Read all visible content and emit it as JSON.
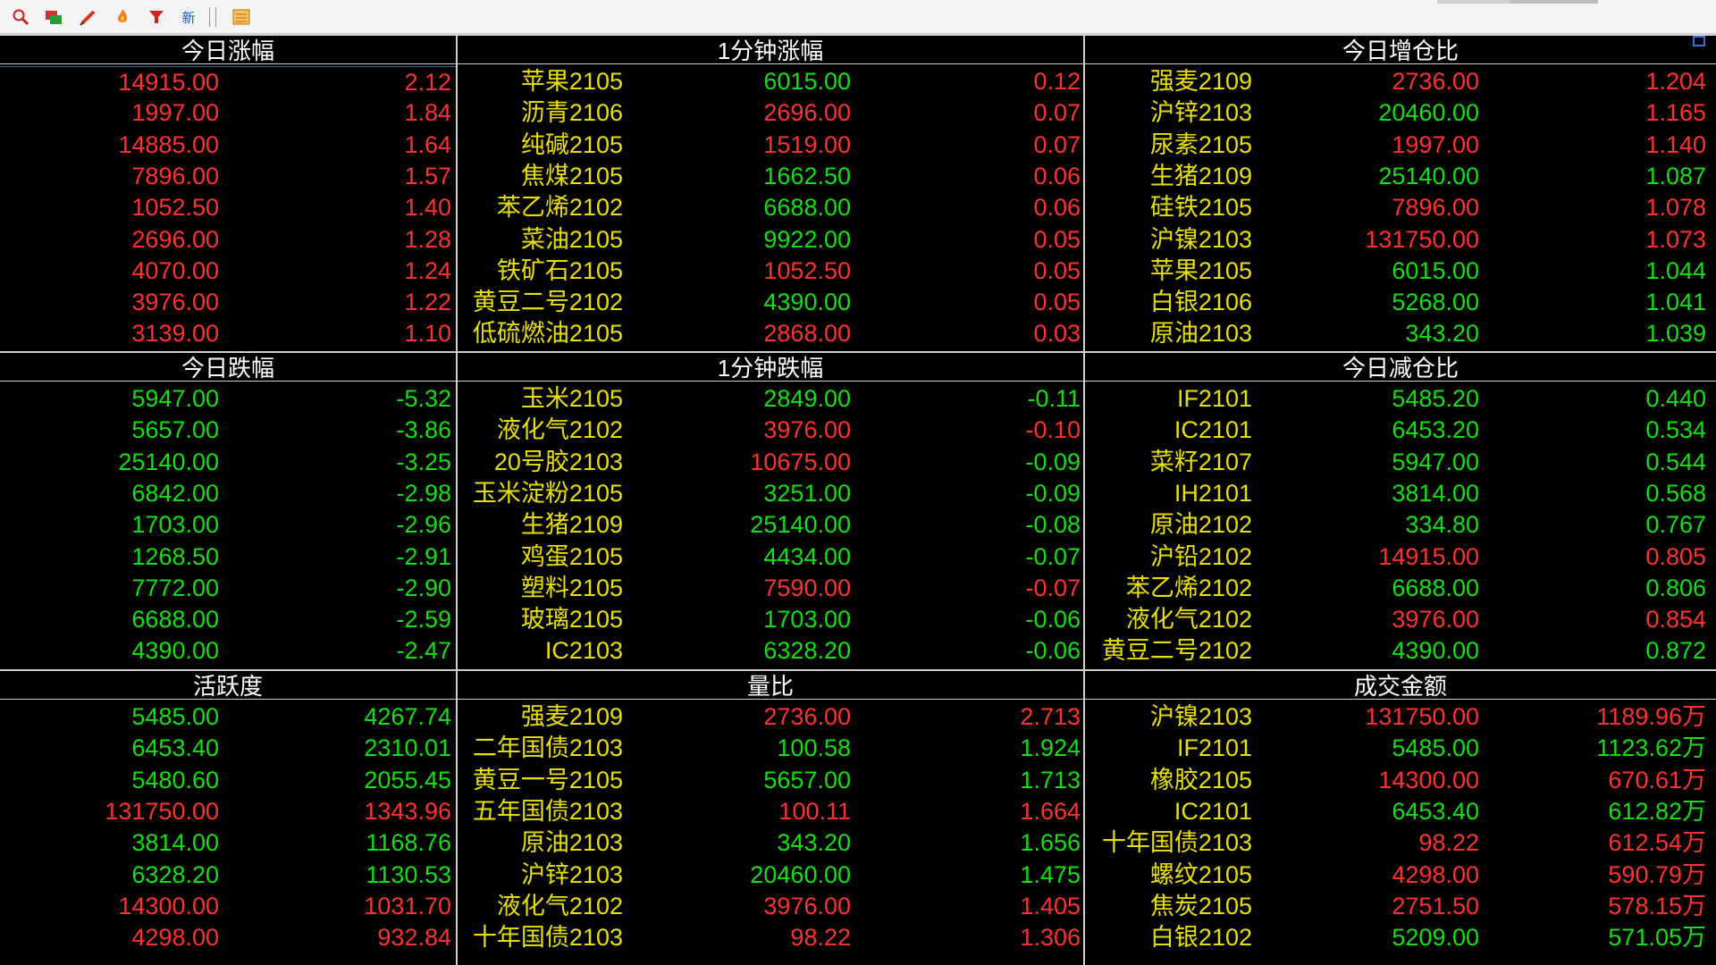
{
  "toolbar": {
    "icons": [
      "search-icon",
      "windows-icon",
      "pen-icon",
      "flame-icon",
      "filter-icon",
      "new-icon",
      "calendar-icon"
    ],
    "new_label": "新"
  },
  "colors": {
    "up": "#ff3030",
    "down": "#10e010",
    "name": "#e8e000",
    "header": "#ffffff",
    "background": "#000000"
  },
  "rows": {
    "r1": [
      {
        "title": "今日涨幅",
        "rows": [
          [
            "14915.00",
            "2.12"
          ],
          [
            "1997.00",
            "1.84"
          ],
          [
            "14885.00",
            "1.64"
          ],
          [
            "7896.00",
            "1.57"
          ],
          [
            "1052.50",
            "1.40"
          ],
          [
            "2696.00",
            "1.28"
          ],
          [
            "4070.00",
            "1.24"
          ],
          [
            "3976.00",
            "1.22"
          ],
          [
            "3139.00",
            "1.10"
          ]
        ],
        "colors": [
          [
            "r",
            "r"
          ],
          [
            "r",
            "r"
          ],
          [
            "r",
            "r"
          ],
          [
            "r",
            "r"
          ],
          [
            "r",
            "r"
          ],
          [
            "r",
            "r"
          ],
          [
            "r",
            "r"
          ],
          [
            "r",
            "r"
          ],
          [
            "r",
            "r"
          ]
        ]
      },
      {
        "title": "1分钟涨幅",
        "rows": [
          [
            "苹果2105",
            "6015.00",
            "0.12"
          ],
          [
            "沥青2106",
            "2696.00",
            "0.07"
          ],
          [
            "纯碱2105",
            "1519.00",
            "0.07"
          ],
          [
            "焦煤2105",
            "1662.50",
            "0.06"
          ],
          [
            "苯乙烯2102",
            "6688.00",
            "0.06"
          ],
          [
            "菜油2105",
            "9922.00",
            "0.05"
          ],
          [
            "铁矿石2105",
            "1052.50",
            "0.05"
          ],
          [
            "黄豆二号2102",
            "4390.00",
            "0.05"
          ],
          [
            "低硫燃油2105",
            "2868.00",
            "0.03"
          ]
        ],
        "colors": [
          [
            "y",
            "g",
            "r"
          ],
          [
            "y",
            "r",
            "r"
          ],
          [
            "y",
            "r",
            "r"
          ],
          [
            "y",
            "g",
            "r"
          ],
          [
            "y",
            "g",
            "r"
          ],
          [
            "y",
            "g",
            "r"
          ],
          [
            "y",
            "r",
            "r"
          ],
          [
            "y",
            "g",
            "r"
          ],
          [
            "y",
            "r",
            "r"
          ]
        ]
      },
      {
        "title": "今日增仓比",
        "rows": [
          [
            "强麦2109",
            "2736.00",
            "1.204"
          ],
          [
            "沪锌2103",
            "20460.00",
            "1.165"
          ],
          [
            "尿素2105",
            "1997.00",
            "1.140"
          ],
          [
            "生猪2109",
            "25140.00",
            "1.087"
          ],
          [
            "硅铁2105",
            "7896.00",
            "1.078"
          ],
          [
            "沪镍2103",
            "131750.00",
            "1.073"
          ],
          [
            "苹果2105",
            "6015.00",
            "1.044"
          ],
          [
            "白银2106",
            "5268.00",
            "1.041"
          ],
          [
            "原油2103",
            "343.20",
            "1.039"
          ]
        ],
        "colors": [
          [
            "y",
            "r",
            "r"
          ],
          [
            "y",
            "g",
            "r"
          ],
          [
            "y",
            "r",
            "r"
          ],
          [
            "y",
            "g",
            "g"
          ],
          [
            "y",
            "r",
            "r"
          ],
          [
            "y",
            "r",
            "r"
          ],
          [
            "y",
            "g",
            "g"
          ],
          [
            "y",
            "g",
            "g"
          ],
          [
            "y",
            "g",
            "g"
          ]
        ]
      }
    ],
    "r2": [
      {
        "title": "今日跌幅",
        "rows": [
          [
            "5947.00",
            "-5.32"
          ],
          [
            "5657.00",
            "-3.86"
          ],
          [
            "25140.00",
            "-3.25"
          ],
          [
            "6842.00",
            "-2.98"
          ],
          [
            "1703.00",
            "-2.96"
          ],
          [
            "1268.50",
            "-2.91"
          ],
          [
            "7772.00",
            "-2.90"
          ],
          [
            "6688.00",
            "-2.59"
          ],
          [
            "4390.00",
            "-2.47"
          ]
        ],
        "colors": [
          [
            "g",
            "g"
          ],
          [
            "g",
            "g"
          ],
          [
            "g",
            "g"
          ],
          [
            "g",
            "g"
          ],
          [
            "g",
            "g"
          ],
          [
            "g",
            "g"
          ],
          [
            "g",
            "g"
          ],
          [
            "g",
            "g"
          ],
          [
            "g",
            "g"
          ]
        ]
      },
      {
        "title": "1分钟跌幅",
        "rows": [
          [
            "玉米2105",
            "2849.00",
            "-0.11"
          ],
          [
            "液化气2102",
            "3976.00",
            "-0.10"
          ],
          [
            "20号胶2103",
            "10675.00",
            "-0.09"
          ],
          [
            "玉米淀粉2105",
            "3251.00",
            "-0.09"
          ],
          [
            "生猪2109",
            "25140.00",
            "-0.08"
          ],
          [
            "鸡蛋2105",
            "4434.00",
            "-0.07"
          ],
          [
            "塑料2105",
            "7590.00",
            "-0.07"
          ],
          [
            "玻璃2105",
            "1703.00",
            "-0.06"
          ],
          [
            "IC2103",
            "6328.20",
            "-0.06"
          ]
        ],
        "colors": [
          [
            "y",
            "g",
            "g"
          ],
          [
            "y",
            "r",
            "r"
          ],
          [
            "y",
            "r",
            "g"
          ],
          [
            "y",
            "g",
            "g"
          ],
          [
            "y",
            "g",
            "g"
          ],
          [
            "y",
            "g",
            "g"
          ],
          [
            "y",
            "r",
            "r"
          ],
          [
            "y",
            "g",
            "g"
          ],
          [
            "y",
            "g",
            "g"
          ]
        ]
      },
      {
        "title": "今日减仓比",
        "rows": [
          [
            "IF2101",
            "5485.20",
            "0.440"
          ],
          [
            "IC2101",
            "6453.20",
            "0.534"
          ],
          [
            "菜籽2107",
            "5947.00",
            "0.544"
          ],
          [
            "IH2101",
            "3814.00",
            "0.568"
          ],
          [
            "原油2102",
            "334.80",
            "0.767"
          ],
          [
            "沪铅2102",
            "14915.00",
            "0.805"
          ],
          [
            "苯乙烯2102",
            "6688.00",
            "0.806"
          ],
          [
            "液化气2102",
            "3976.00",
            "0.854"
          ],
          [
            "黄豆二号2102",
            "4390.00",
            "0.872"
          ]
        ],
        "colors": [
          [
            "y",
            "g",
            "g"
          ],
          [
            "y",
            "g",
            "g"
          ],
          [
            "y",
            "g",
            "g"
          ],
          [
            "y",
            "g",
            "g"
          ],
          [
            "y",
            "g",
            "g"
          ],
          [
            "y",
            "r",
            "r"
          ],
          [
            "y",
            "g",
            "g"
          ],
          [
            "y",
            "r",
            "r"
          ],
          [
            "y",
            "g",
            "g"
          ]
        ]
      }
    ],
    "r3": [
      {
        "title": "活跃度",
        "rows": [
          [
            "5485.00",
            "4267.74"
          ],
          [
            "6453.40",
            "2310.01"
          ],
          [
            "5480.60",
            "2055.45"
          ],
          [
            "131750.00",
            "1343.96"
          ],
          [
            "3814.00",
            "1168.76"
          ],
          [
            "6328.20",
            "1130.53"
          ],
          [
            "14300.00",
            "1031.70"
          ],
          [
            "4298.00",
            "932.84"
          ]
        ],
        "colors": [
          [
            "g",
            "g"
          ],
          [
            "g",
            "g"
          ],
          [
            "g",
            "g"
          ],
          [
            "r",
            "r"
          ],
          [
            "g",
            "g"
          ],
          [
            "g",
            "g"
          ],
          [
            "r",
            "r"
          ],
          [
            "r",
            "r"
          ]
        ]
      },
      {
        "title": "量比",
        "rows": [
          [
            "强麦2109",
            "2736.00",
            "2.713"
          ],
          [
            "二年国债2103",
            "100.58",
            "1.924"
          ],
          [
            "黄豆一号2105",
            "5657.00",
            "1.713"
          ],
          [
            "五年国债2103",
            "100.11",
            "1.664"
          ],
          [
            "原油2103",
            "343.20",
            "1.656"
          ],
          [
            "沪锌2103",
            "20460.00",
            "1.475"
          ],
          [
            "液化气2102",
            "3976.00",
            "1.405"
          ],
          [
            "十年国债2103",
            "98.22",
            "1.306"
          ]
        ],
        "colors": [
          [
            "y",
            "r",
            "r"
          ],
          [
            "y",
            "g",
            "g"
          ],
          [
            "y",
            "g",
            "g"
          ],
          [
            "y",
            "r",
            "r"
          ],
          [
            "y",
            "g",
            "g"
          ],
          [
            "y",
            "g",
            "g"
          ],
          [
            "y",
            "r",
            "r"
          ],
          [
            "y",
            "r",
            "r"
          ]
        ]
      },
      {
        "title": "成交金额",
        "rows": [
          [
            "沪镍2103",
            "131750.00",
            "1189.96万"
          ],
          [
            "IF2101",
            "5485.00",
            "1123.62万"
          ],
          [
            "橡胶2105",
            "14300.00",
            "670.61万"
          ],
          [
            "IC2101",
            "6453.40",
            "612.82万"
          ],
          [
            "十年国债2103",
            "98.22",
            "612.54万"
          ],
          [
            "螺纹2105",
            "4298.00",
            "590.79万"
          ],
          [
            "焦炭2105",
            "2751.50",
            "578.15万"
          ],
          [
            "白银2102",
            "5209.00",
            "571.05万"
          ]
        ],
        "colors": [
          [
            "y",
            "r",
            "r"
          ],
          [
            "y",
            "g",
            "g"
          ],
          [
            "y",
            "r",
            "r"
          ],
          [
            "y",
            "g",
            "g"
          ],
          [
            "y",
            "r",
            "r"
          ],
          [
            "y",
            "r",
            "r"
          ],
          [
            "y",
            "r",
            "r"
          ],
          [
            "y",
            "g",
            "g"
          ]
        ]
      }
    ]
  }
}
